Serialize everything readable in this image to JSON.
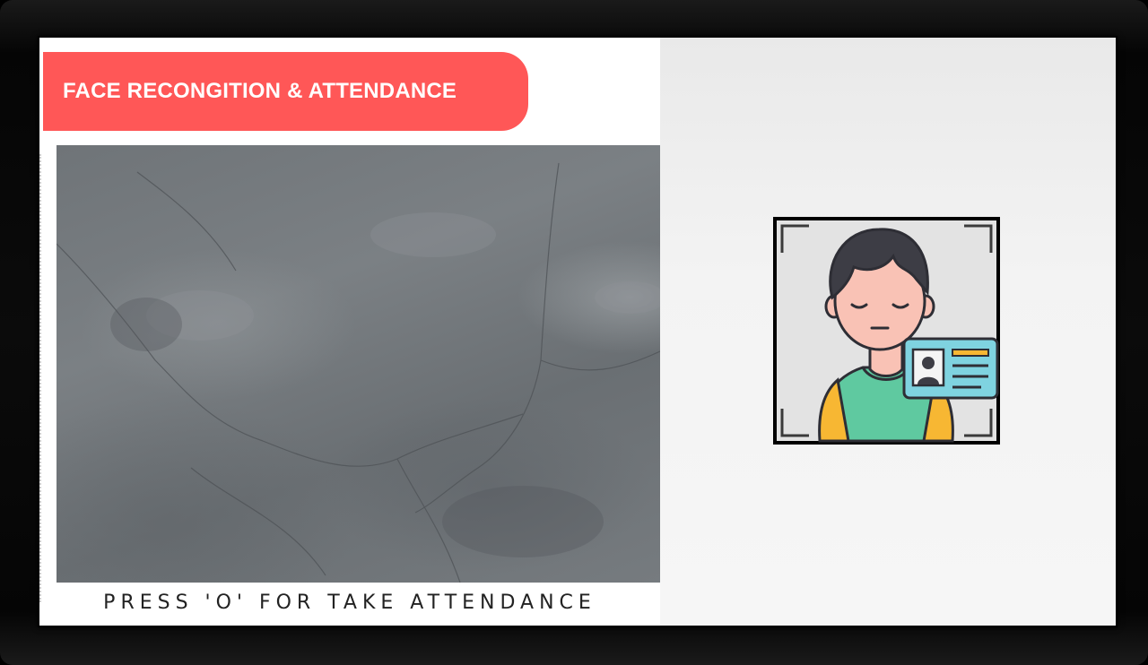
{
  "app": {
    "title": "FACE RECONGITION & ATTENDANCE",
    "instruction": "PRESS 'O' FOR TAKE ATTENDANCE"
  },
  "camera_feed": {
    "state": "idle",
    "background": "grey-texture"
  },
  "avatar": {
    "icon": "face-id-user-icon",
    "badge_icon": "id-card-icon"
  },
  "colors": {
    "banner": "#ff5757",
    "banner_text": "#ffffff",
    "frame": "#000000",
    "shirt": "#5fc9a0",
    "sleeves": "#f7b733",
    "card": "#7fd3e0",
    "skin": "#f9c2b5",
    "hair": "#3d3d45"
  }
}
